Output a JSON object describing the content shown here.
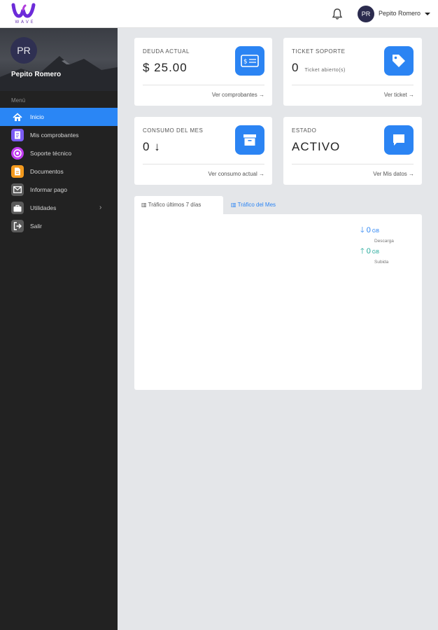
{
  "topbar": {
    "logo_text": "WAVE",
    "user_initials": "PR",
    "user_name": "Pepito Romero"
  },
  "sidebar": {
    "avatar_initials": "PR",
    "user_name": "Pepito Romero",
    "menu_title": "Menú",
    "items": [
      {
        "label": "Inicio",
        "icon": "home-icon",
        "color": "#2a86f5"
      },
      {
        "label": "Mis comprobantes",
        "icon": "receipt-icon",
        "color": "#7b5cf5"
      },
      {
        "label": "Soporte técnico",
        "icon": "support-icon",
        "color": "#c03bf0"
      },
      {
        "label": "Documentos",
        "icon": "document-icon",
        "color": "#f39a1e"
      },
      {
        "label": "Informar pago",
        "icon": "mail-icon",
        "color": "#5a5a5a"
      },
      {
        "label": "Utilidades",
        "icon": "briefcase-icon",
        "color": "#5a5a5a"
      },
      {
        "label": "Salir",
        "icon": "logout-icon",
        "color": "#5a5a5a"
      }
    ]
  },
  "cards": {
    "deuda": {
      "label": "DEUDA ACTUAL",
      "value": "$ 25.00",
      "link": "Ver comprobantes"
    },
    "ticket": {
      "label": "TICKET SOPORTE",
      "value": "0",
      "sub": "Ticket abierto(s)",
      "link": "Ver ticket"
    },
    "consumo": {
      "label": "CONSUMO DEL MES",
      "value": "0",
      "link": "Ver consumo actual"
    },
    "estado": {
      "label": "ESTADO",
      "value": "ACTIVO",
      "link": "Ver Mis datos"
    }
  },
  "traffic": {
    "tab_week": "Tráfico últimos 7 días",
    "tab_month": "Tráfico del Mes",
    "download": {
      "value": "0",
      "unit": "GB",
      "caption": "Descarga",
      "color": "#2b84f3"
    },
    "upload": {
      "value": "0",
      "unit": "GB",
      "caption": "Subida",
      "color": "#22a99a"
    }
  },
  "colors": {
    "accent": "#2a86f5",
    "sidebar_bg": "#222222",
    "page_bg": "#e4e6e9"
  }
}
